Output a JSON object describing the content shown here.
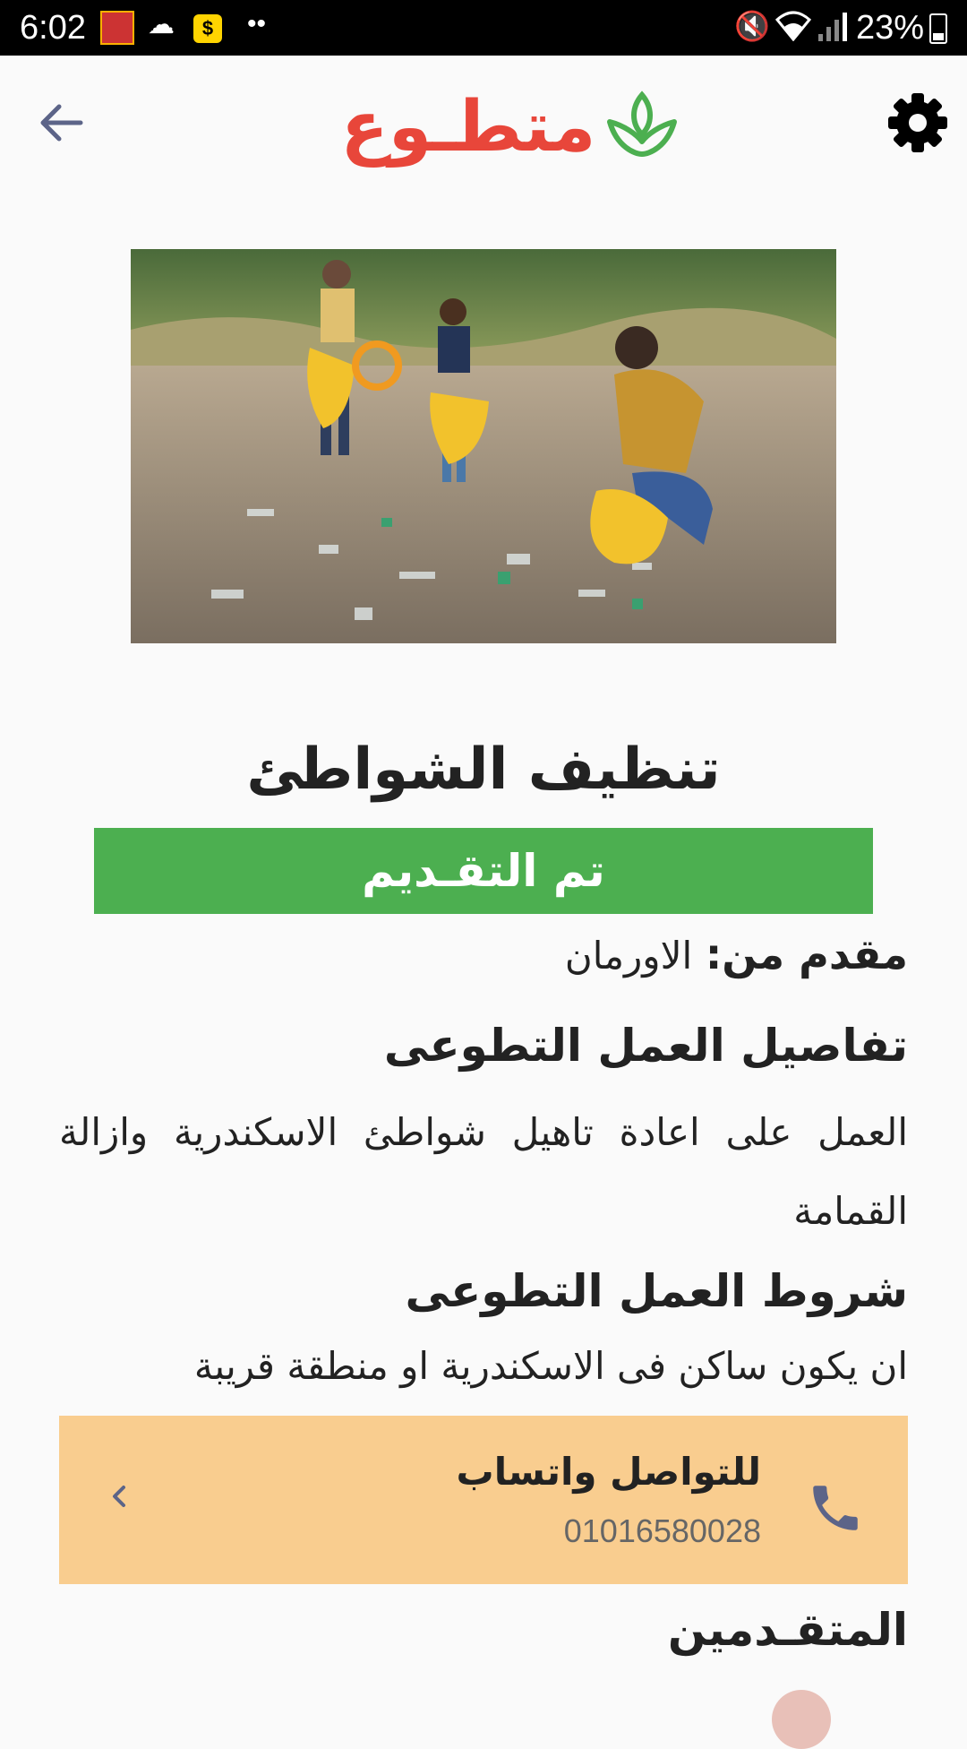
{
  "status_bar": {
    "time": "6:02",
    "battery": "23%"
  },
  "app_bar": {
    "logo_text": "متطـوع",
    "logo_color": "#e8463a",
    "leaf_color": "#4caf50"
  },
  "opportunity": {
    "title": "تنظيف الشواطئ",
    "status": "تم التقـديم",
    "provider_label": "مقدم من:",
    "provider_name": "الاورمان",
    "details_heading": "تفاصيل العمل التطوعى",
    "details_text": "العمل على اعادة تاهيل شواطئ الاسكندرية وازالة القمامة",
    "conditions_heading": "شروط العمل التطوعى",
    "conditions_text": "ان يكون ساكن فى الاسكندرية او منطقة قريبة"
  },
  "contact": {
    "label": "للتواصل واتساب",
    "phone": "01016580028"
  },
  "applicants": {
    "heading": "المتقـدمين"
  },
  "colors": {
    "accent_green": "#4caf50",
    "contact_bg": "#f9cd8f",
    "icon_slate": "#5c6488"
  }
}
